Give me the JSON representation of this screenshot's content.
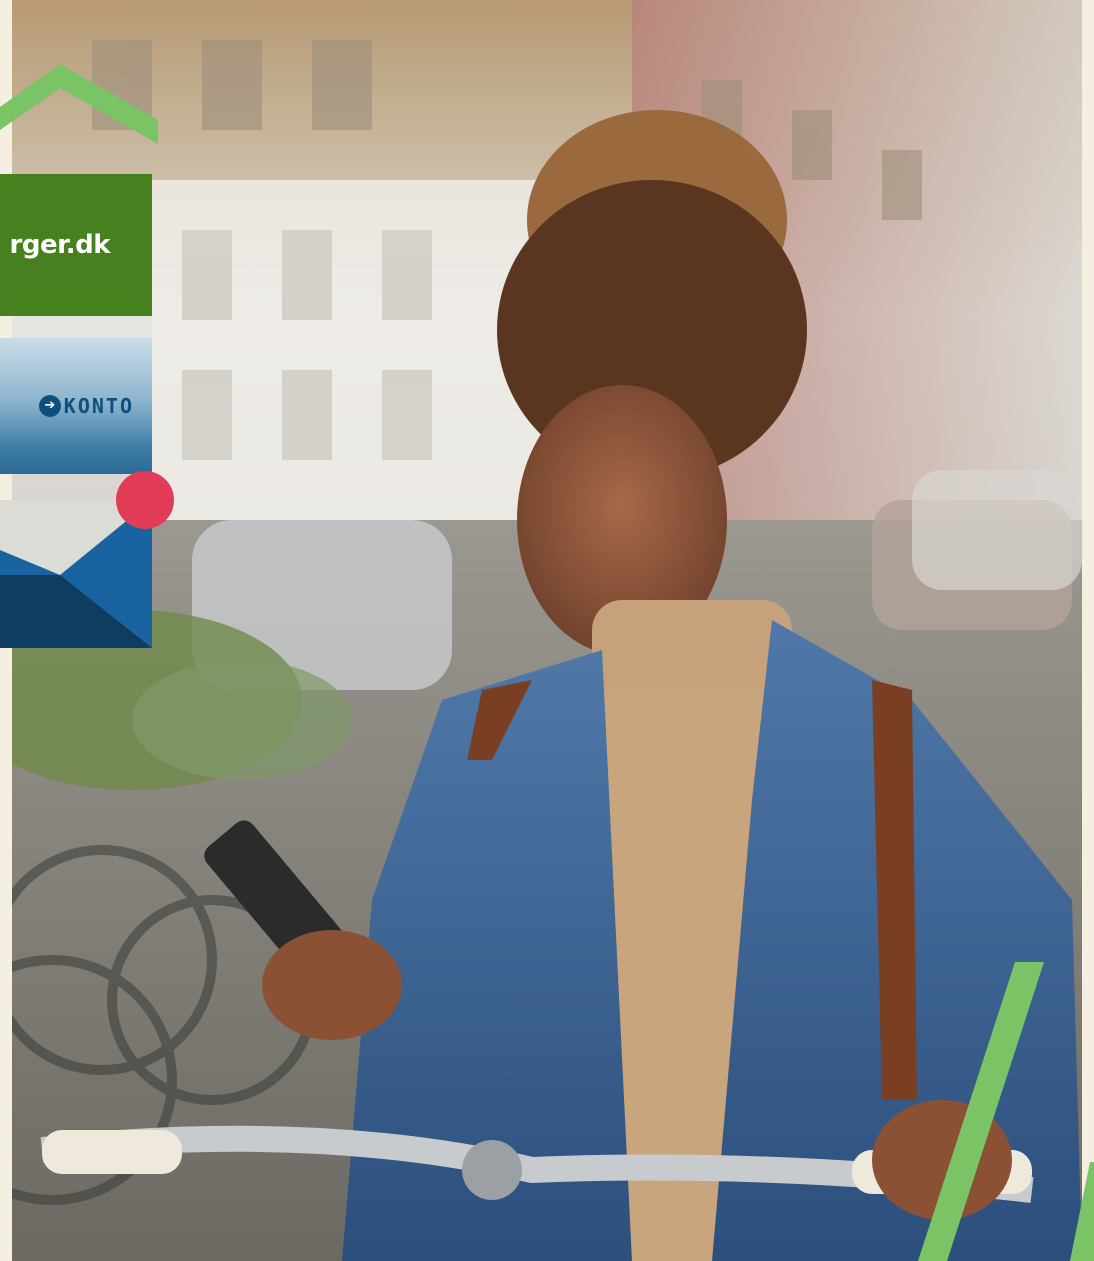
{
  "tiles": {
    "borger": {
      "label": "rger.dk",
      "bg_color": "#46801f"
    },
    "nemkonto": {
      "label": "KONTO",
      "icon": "arrow-right-icon",
      "accent": "#0f4f7e"
    },
    "mail": {
      "icon": "envelope-icon",
      "notification_color": "#e23b57"
    }
  },
  "decor": {
    "accent_green": "#7bc465",
    "background": "#f5efe2"
  },
  "photo": {
    "icon": "person-with-phone-on-bicycle"
  }
}
